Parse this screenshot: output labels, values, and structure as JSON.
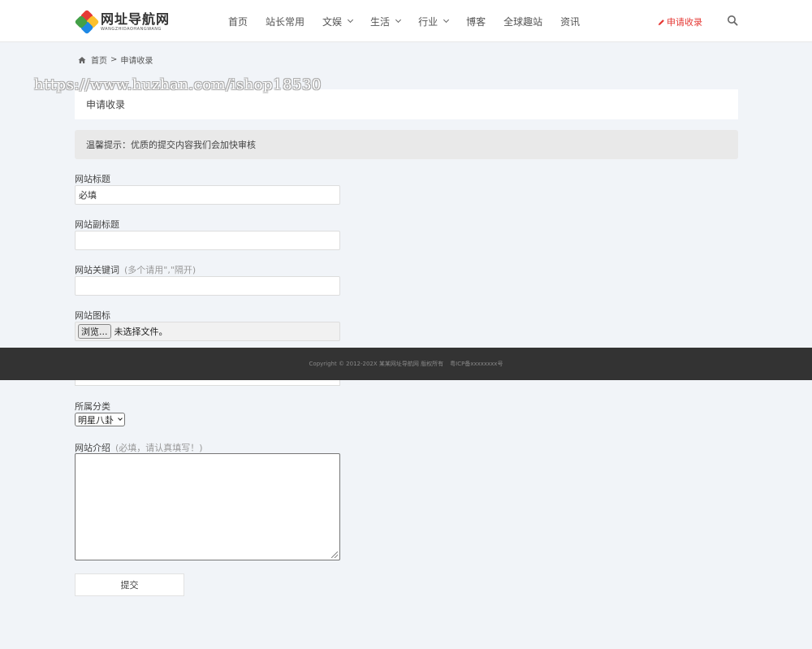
{
  "header": {
    "logo_title": "网址导航网",
    "logo_sub": "WANGZHIDAOHANGWANG",
    "nav": [
      {
        "label": "首页",
        "dropdown": false
      },
      {
        "label": "站长常用",
        "dropdown": false
      },
      {
        "label": "文娱",
        "dropdown": true
      },
      {
        "label": "生活",
        "dropdown": true
      },
      {
        "label": "行业",
        "dropdown": true
      },
      {
        "label": "博客",
        "dropdown": false
      },
      {
        "label": "全球趣站",
        "dropdown": false
      },
      {
        "label": "资讯",
        "dropdown": false
      }
    ],
    "apply_label": "申请收录",
    "accent": "#e53935"
  },
  "breadcrumb": {
    "home": "首页",
    "sep": ">",
    "current": "申请收录"
  },
  "watermark": "https://www.huzhan.com/ishop18530",
  "page_title": "申请收录",
  "notice": "温馨提示：优质的提交内容我们会加快审核",
  "form": {
    "site_title_label": "网站标题",
    "site_title_placeholder": "必填",
    "subtitle_label": "网站副标题",
    "keywords_label": "网站关键词",
    "keywords_hint": "(多个请用\",\"隔开)",
    "icon_label": "网站图标",
    "file_button": "浏览...",
    "file_status": "未选择文件。",
    "category_label": "所属分类",
    "category_selected": "明星八卦",
    "intro_label": "网站介绍",
    "intro_hint": "(必填，请认真填写！)",
    "submit_label": "提交"
  },
  "footer": {
    "copyright": "Copyright © 2012-202X 某某网址导航网 版权所有",
    "icp": "粤ICP备xxxxxxxx号"
  }
}
